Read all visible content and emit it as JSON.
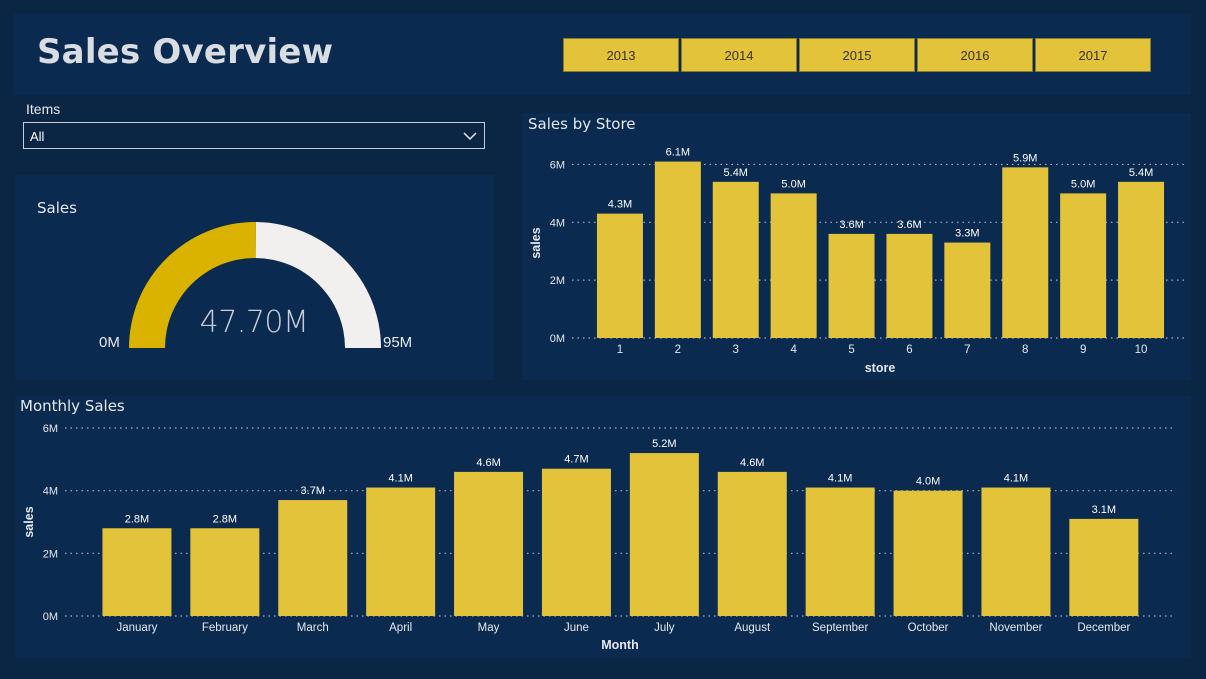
{
  "header": {
    "title": "Sales Overview",
    "years": [
      "2013",
      "2014",
      "2015",
      "2016",
      "2017"
    ]
  },
  "filter": {
    "label": "Items",
    "value": "All"
  },
  "gauge": {
    "title": "Sales",
    "value_label": "47.70M",
    "min_label": "0M",
    "max_label": "95M",
    "value": 47.7,
    "min": 0,
    "max": 95,
    "fill_color": "#d9b300",
    "track_color": "#f2f0ee"
  },
  "colors": {
    "bar": "#e2c33a",
    "background": "#0b2545",
    "panel": "#0a2a4f",
    "text": "#e6e9ee"
  },
  "chart_data": [
    {
      "type": "bar",
      "title": "Sales by Store",
      "xlabel": "store",
      "ylabel": "sales",
      "categories": [
        "1",
        "2",
        "3",
        "4",
        "5",
        "6",
        "7",
        "8",
        "9",
        "10"
      ],
      "values": [
        4.3,
        6.1,
        5.4,
        5.0,
        3.6,
        3.6,
        3.3,
        5.9,
        5.0,
        5.4
      ],
      "data_labels": [
        "4.3M",
        "6.1M",
        "5.4M",
        "5.0M",
        "3.6M",
        "3.6M",
        "3.3M",
        "5.9M",
        "5.0M",
        "5.4M"
      ],
      "ylim": [
        0,
        6.5
      ],
      "yticks": [
        0,
        2,
        4,
        6
      ],
      "ytick_labels": [
        "0M",
        "2M",
        "4M",
        "6M"
      ],
      "grid": true
    },
    {
      "type": "bar",
      "title": "Monthly Sales",
      "xlabel": "Month",
      "ylabel": "sales",
      "categories": [
        "January",
        "February",
        "March",
        "April",
        "May",
        "June",
        "July",
        "August",
        "September",
        "October",
        "November",
        "December"
      ],
      "values": [
        2.8,
        2.8,
        3.7,
        4.1,
        4.6,
        4.7,
        5.2,
        4.6,
        4.1,
        4.0,
        4.1,
        3.1
      ],
      "data_labels": [
        "2.8M",
        "2.8M",
        "3.7M",
        "4.1M",
        "4.6M",
        "4.7M",
        "5.2M",
        "4.6M",
        "4.1M",
        "4.0M",
        "4.1M",
        "3.1M"
      ],
      "ylim": [
        0,
        6
      ],
      "yticks": [
        0,
        2,
        4,
        6
      ],
      "ytick_labels": [
        "0M",
        "2M",
        "4M",
        "6M"
      ],
      "grid": true
    }
  ]
}
